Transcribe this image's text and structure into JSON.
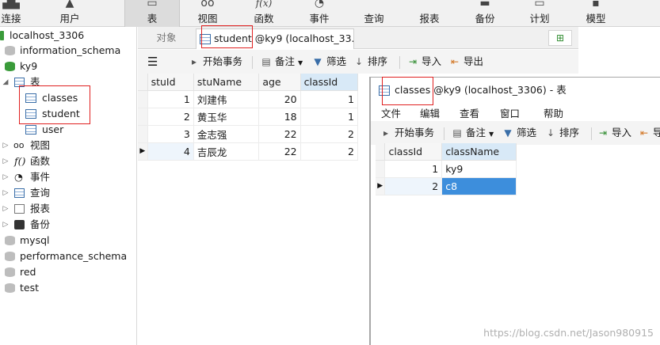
{
  "toolbar": {
    "items": [
      {
        "label": "连接",
        "icon": "connection-icon"
      },
      {
        "label": "用户",
        "icon": "user-icon"
      },
      {
        "label": "表",
        "icon": "table-icon"
      },
      {
        "label": "视图",
        "icon": "view-icon"
      },
      {
        "label": "函数",
        "icon": "function-icon"
      },
      {
        "label": "事件",
        "icon": "event-icon"
      },
      {
        "label": "查询",
        "icon": "query-icon"
      },
      {
        "label": "报表",
        "icon": "report-icon"
      },
      {
        "label": "备份",
        "icon": "backup-icon"
      },
      {
        "label": "计划",
        "icon": "schedule-icon"
      },
      {
        "label": "模型",
        "icon": "model-icon"
      }
    ],
    "function_glyph": "f(x)"
  },
  "sidebar": {
    "connection": "localhost_3306",
    "databases_before": [
      "information_schema"
    ],
    "active_db": "ky9",
    "tables_group": "表",
    "tables": [
      "classes",
      "student",
      "user"
    ],
    "groups": [
      "视图",
      "函数",
      "事件",
      "查询",
      "报表",
      "备份"
    ],
    "databases_after": [
      "mysql",
      "performance_schema",
      "red",
      "test"
    ]
  },
  "tabs": {
    "objects": "对象",
    "student": "student @ky9 (localhost_33..."
  },
  "main_toolbar": {
    "begin_tx": "开始事务",
    "memo": "备注",
    "filter": "筛选",
    "sort": "排序",
    "import": "导入",
    "export": "导出"
  },
  "student_grid": {
    "columns": [
      "stuId",
      "stuName",
      "age",
      "classId"
    ],
    "rows": [
      {
        "stuId": "1",
        "stuName": "刘建伟",
        "age": "20",
        "classId": "1"
      },
      {
        "stuId": "2",
        "stuName": "黄玉华",
        "age": "18",
        "classId": "1"
      },
      {
        "stuId": "3",
        "stuName": "金志强",
        "age": "22",
        "classId": "2"
      },
      {
        "stuId": "4",
        "stuName": "吉辰龙",
        "age": "22",
        "classId": "2"
      }
    ]
  },
  "classes_window": {
    "title": "classes @ky9 (localhost_3306) - 表",
    "menu": [
      "文件",
      "编辑",
      "查看",
      "窗口",
      "帮助"
    ],
    "toolbar": {
      "begin_tx": "开始事务",
      "memo": "备注",
      "filter": "筛选",
      "sort": "排序",
      "import": "导入",
      "export": "导"
    },
    "columns": [
      "classId",
      "className"
    ],
    "rows": [
      {
        "classId": "1",
        "className": "ky9"
      },
      {
        "classId": "2",
        "className": "c8"
      }
    ]
  },
  "watermark": "https://blog.csdn.net/Jason980915",
  "colors": {
    "selection": "#3d8edc",
    "highlight_box": "#e02020",
    "db_active": "#3a9b3a"
  }
}
